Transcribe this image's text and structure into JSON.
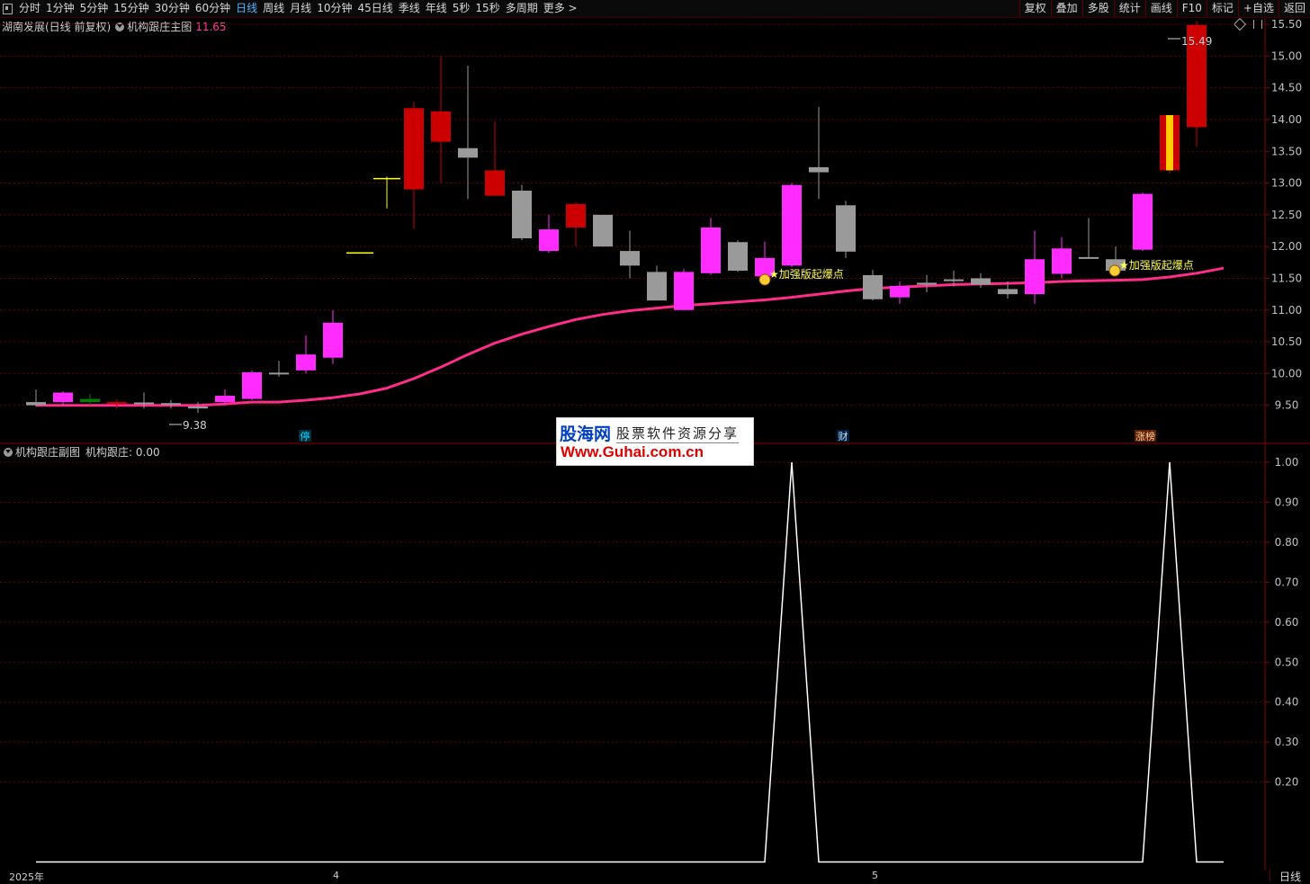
{
  "toolbar": {
    "periods": [
      "分时",
      "1分钟",
      "5分钟",
      "15分钟",
      "30分钟",
      "60分钟",
      "日线",
      "周线",
      "月线",
      "10分钟",
      "45日线",
      "季线",
      "年线",
      "5秒",
      "15秒",
      "多周期",
      "更多 >"
    ],
    "active_period": "日线",
    "right_buttons": [
      "复权",
      "叠加",
      "多股",
      "统计",
      "画线",
      "F10",
      "标记",
      "+自选",
      "返回"
    ]
  },
  "main_panel": {
    "stock_name": "湖南发展(日线 前复权)",
    "indicator_name": "机构跟庄主图",
    "indicator_value": "11.65",
    "high_marker": "15.49",
    "low_marker": "9.38",
    "signal_labels": [
      "★加强版起爆点",
      "★加强版起爆点"
    ],
    "event_tags": [
      "停",
      "财",
      "涨榜"
    ],
    "price_ticks": [
      "15.50",
      "15.00",
      "14.50",
      "14.00",
      "13.50",
      "13.00",
      "12.50",
      "12.00",
      "11.50",
      "11.00",
      "10.50",
      "10.00",
      "9.50"
    ]
  },
  "sub_panel": {
    "indicator_name": "机构跟庄副图",
    "line_label": "机构跟庄: 0.00",
    "ticks": [
      "1.00",
      "0.90",
      "0.80",
      "0.70",
      "0.60",
      "0.50",
      "0.40",
      "0.30",
      "0.20"
    ]
  },
  "x_axis": {
    "labels": [
      "2025年",
      "4",
      "5"
    ],
    "period_button": "日线"
  },
  "watermark": {
    "logo": "股海网",
    "tagline": "股票软件资源分享",
    "url": "Www.Guhai.com.cn"
  },
  "colors": {
    "up_candle": "#ff2bff",
    "down_candle": "#cc0000",
    "neutral_candle": "#9a9a9a",
    "ma_line": "#ff2d8a",
    "signal_text": "#ffff55",
    "grid": "#6a0000"
  },
  "chart_data": [
    {
      "type": "candlestick",
      "title": "机构跟庄主图",
      "ylim": [
        9.3,
        15.6
      ],
      "candles": [
        {
          "o": 9.55,
          "h": 9.75,
          "l": 9.48,
          "c": 9.5,
          "k": "n"
        },
        {
          "o": 9.55,
          "h": 9.72,
          "l": 9.5,
          "c": 9.7,
          "k": "u"
        },
        {
          "o": 9.6,
          "h": 9.68,
          "l": 9.5,
          "c": 9.55,
          "k": "g"
        },
        {
          "o": 9.55,
          "h": 9.6,
          "l": 9.45,
          "c": 9.52,
          "k": "d"
        },
        {
          "o": 9.52,
          "h": 9.7,
          "l": 9.45,
          "c": 9.53,
          "k": "n"
        },
        {
          "o": 9.5,
          "h": 9.58,
          "l": 9.45,
          "c": 9.52,
          "k": "n"
        },
        {
          "o": 9.45,
          "h": 9.55,
          "l": 9.38,
          "c": 9.48,
          "k": "n"
        },
        {
          "o": 9.55,
          "h": 9.75,
          "l": 9.5,
          "c": 9.65,
          "k": "u"
        },
        {
          "o": 9.6,
          "h": 10.05,
          "l": 9.58,
          "c": 10.02,
          "k": "u"
        },
        {
          "o": 10.0,
          "h": 10.2,
          "l": 9.95,
          "c": 10.0,
          "k": "n"
        },
        {
          "o": 10.05,
          "h": 10.6,
          "l": 10.0,
          "c": 10.3,
          "k": "u"
        },
        {
          "o": 10.25,
          "h": 11.0,
          "l": 10.15,
          "c": 10.8,
          "k": "u"
        },
        {
          "o": 11.9,
          "h": 11.9,
          "l": 11.9,
          "c": 11.9,
          "k": "y"
        },
        {
          "o": 13.07,
          "h": 13.1,
          "l": 12.6,
          "c": 13.07,
          "k": "y"
        },
        {
          "o": 14.18,
          "h": 14.28,
          "l": 12.28,
          "c": 12.9,
          "k": "d"
        },
        {
          "o": 14.13,
          "h": 15.0,
          "l": 13.0,
          "c": 13.65,
          "k": "d"
        },
        {
          "o": 13.55,
          "h": 14.85,
          "l": 12.75,
          "c": 13.4,
          "k": "n"
        },
        {
          "o": 13.2,
          "h": 13.97,
          "l": 12.8,
          "c": 12.8,
          "k": "d"
        },
        {
          "o": 12.88,
          "h": 12.97,
          "l": 12.1,
          "c": 12.13,
          "k": "n"
        },
        {
          "o": 11.93,
          "h": 12.5,
          "l": 11.9,
          "c": 12.27,
          "k": "u"
        },
        {
          "o": 12.67,
          "h": 12.7,
          "l": 12.0,
          "c": 12.3,
          "k": "d"
        },
        {
          "o": 12.5,
          "h": 12.5,
          "l": 12.0,
          "c": 12.0,
          "k": "n"
        },
        {
          "o": 11.93,
          "h": 12.25,
          "l": 11.5,
          "c": 11.7,
          "k": "n"
        },
        {
          "o": 11.6,
          "h": 11.7,
          "l": 11.15,
          "c": 11.15,
          "k": "n"
        },
        {
          "o": 11.0,
          "h": 11.65,
          "l": 11.0,
          "c": 11.6,
          "k": "u"
        },
        {
          "o": 11.58,
          "h": 12.45,
          "l": 11.55,
          "c": 12.3,
          "k": "u"
        },
        {
          "o": 12.07,
          "h": 12.1,
          "l": 11.6,
          "c": 11.62,
          "k": "n"
        },
        {
          "o": 11.53,
          "h": 12.08,
          "l": 11.5,
          "c": 11.82,
          "k": "u"
        },
        {
          "o": 11.7,
          "h": 13.0,
          "l": 11.68,
          "c": 12.97,
          "k": "u"
        },
        {
          "o": 13.25,
          "h": 14.2,
          "l": 12.75,
          "c": 13.17,
          "k": "n"
        },
        {
          "o": 12.65,
          "h": 12.72,
          "l": 11.82,
          "c": 11.92,
          "k": "n"
        },
        {
          "o": 11.55,
          "h": 11.63,
          "l": 11.15,
          "c": 11.17,
          "k": "n"
        },
        {
          "o": 11.2,
          "h": 11.45,
          "l": 11.1,
          "c": 11.38,
          "k": "u"
        },
        {
          "o": 11.43,
          "h": 11.55,
          "l": 11.28,
          "c": 11.4,
          "k": "n"
        },
        {
          "o": 11.47,
          "h": 11.62,
          "l": 11.37,
          "c": 11.47,
          "k": "n"
        },
        {
          "o": 11.5,
          "h": 11.58,
          "l": 11.35,
          "c": 11.4,
          "k": "n"
        },
        {
          "o": 11.33,
          "h": 11.45,
          "l": 11.18,
          "c": 11.25,
          "k": "n"
        },
        {
          "o": 11.25,
          "h": 12.25,
          "l": 11.1,
          "c": 11.8,
          "k": "u"
        },
        {
          "o": 11.57,
          "h": 12.15,
          "l": 11.5,
          "c": 11.97,
          "k": "u"
        },
        {
          "o": 11.82,
          "h": 12.45,
          "l": 11.82,
          "c": 11.82,
          "k": "n"
        },
        {
          "o": 11.8,
          "h": 12.0,
          "l": 11.58,
          "c": 11.62,
          "k": "n"
        },
        {
          "o": 11.95,
          "h": 12.85,
          "l": 11.93,
          "c": 12.83,
          "k": "u"
        },
        {
          "o": 14.07,
          "h": 14.07,
          "l": 13.15,
          "c": 13.2,
          "k": "x"
        },
        {
          "o": 15.49,
          "h": 15.55,
          "l": 13.57,
          "c": 13.88,
          "k": "d"
        }
      ],
      "ma": [
        9.5,
        9.5,
        9.5,
        9.5,
        9.5,
        9.5,
        9.5,
        9.52,
        9.55,
        9.55,
        9.58,
        9.62,
        9.68,
        9.77,
        9.92,
        10.1,
        10.3,
        10.48,
        10.62,
        10.74,
        10.85,
        10.93,
        10.99,
        11.03,
        11.07,
        11.1,
        11.13,
        11.16,
        11.2,
        11.25,
        11.3,
        11.34,
        11.36,
        11.38,
        11.4,
        11.41,
        11.42,
        11.43,
        11.45,
        11.46,
        11.47,
        11.48,
        11.52,
        11.58,
        11.66
      ]
    },
    {
      "type": "line",
      "title": "机构跟庄副图",
      "series": [
        {
          "name": "机构跟庄",
          "values": [
            0,
            0,
            0,
            0,
            0,
            0,
            0,
            0,
            0,
            0,
            0,
            0,
            0,
            0,
            0,
            0,
            0,
            0,
            0,
            0,
            0,
            0,
            0,
            0,
            0,
            0,
            0,
            0,
            1,
            0,
            0,
            0,
            0,
            0,
            0,
            0,
            0,
            0,
            0,
            0,
            0,
            0,
            1,
            0,
            0
          ]
        }
      ],
      "ylim": [
        -0.03,
        1.03
      ]
    }
  ]
}
